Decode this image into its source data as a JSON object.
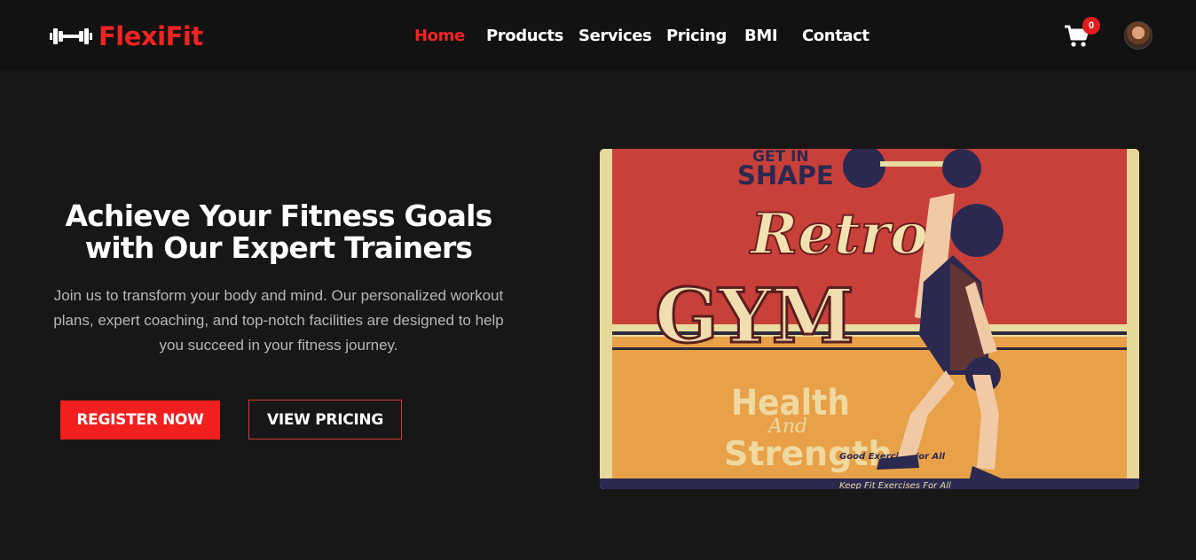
{
  "brand": {
    "name": "FlexiFit",
    "logo_icon": "dumbbell-icon",
    "color": "#f02323"
  },
  "nav": {
    "items": [
      {
        "label": "Home",
        "active": true
      },
      {
        "label": "Products",
        "active": false
      },
      {
        "label": "Services",
        "active": false
      },
      {
        "label": "Pricing",
        "active": false
      },
      {
        "label": "BMI",
        "active": false
      },
      {
        "label": "Contact",
        "active": false
      }
    ],
    "cart_icon": "shopping-cart-icon",
    "cart_count": "0",
    "avatar_icon": "user-avatar"
  },
  "hero": {
    "title": "Achieve Your Fitness Goals with Our Expert Trainers",
    "text": "Join us to transform your body and mind. Our personalized workout plans, expert coaching, and top-notch facilities are designed to help you succeed in your fitness journey.",
    "register_label": "REGISTER NOW",
    "pricing_label": "VIEW PRICING"
  },
  "poster": {
    "line1": "GET IN",
    "line2": "SHAPE",
    "script": "Retro",
    "big": "GYM",
    "sub1": "Health",
    "sub2": "And",
    "sub3": "Strength",
    "small1": "Good Exercise For All",
    "bottom": "Keep Fit Exercises For All"
  },
  "colors": {
    "accent": "#f21f1f",
    "background": "#171717",
    "navbar": "#121212"
  }
}
